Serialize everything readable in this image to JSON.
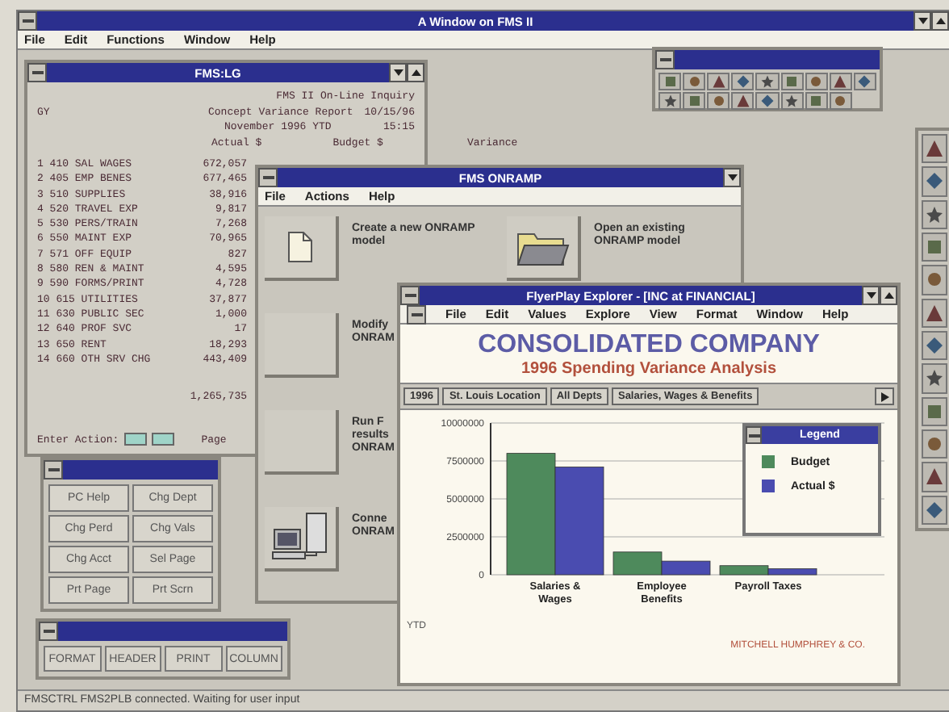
{
  "window": {
    "title": "A Window on FMS II"
  },
  "menu": [
    "File",
    "Edit",
    "Functions",
    "Window",
    "Help"
  ],
  "report": {
    "title": "FMS:LG",
    "header_right": "FMS II On-Line Inquiry",
    "code": "GY",
    "heading": "Concept Variance Report",
    "period": "November 1996 YTD",
    "date": "10/15/96",
    "time": "15:15",
    "columns": [
      "Actual $",
      "Budget $",
      "Variance"
    ],
    "rows": [
      {
        "label": "1 410 SAL WAGES",
        "actual": "672,057"
      },
      {
        "label": "2 405 EMP BENES",
        "actual": "677,465"
      },
      {
        "label": "3 510 SUPPLIES",
        "actual": "38,916"
      },
      {
        "label": "4 520 TRAVEL EXP",
        "actual": "9,817"
      },
      {
        "label": "5 530 PERS/TRAIN",
        "actual": "7,268"
      },
      {
        "label": "6 550 MAINT EXP",
        "actual": "70,965"
      },
      {
        "label": "7 571 OFF EQUIP",
        "actual": "827"
      },
      {
        "label": "8 580 REN & MAINT",
        "actual": "4,595"
      },
      {
        "label": "9 590 FORMS/PRINT",
        "actual": "4,728"
      },
      {
        "label": "10 615 UTILITIES",
        "actual": "37,877"
      },
      {
        "label": "11 630 PUBLIC SEC",
        "actual": "1,000"
      },
      {
        "label": "12 640 PROF SVC",
        "actual": "17"
      },
      {
        "label": "13 650 RENT",
        "actual": "18,293"
      },
      {
        "label": "14 660 OTH SRV CHG",
        "actual": "443,409"
      }
    ],
    "total": "1,265,735",
    "action_label": "Enter Action:",
    "page_label": "Page"
  },
  "keys": [
    "PC Help",
    "Chg Dept",
    "Chg Perd",
    "Chg Vals",
    "Chg Acct",
    "Sel Page",
    "Prt Page",
    "Prt Scrn"
  ],
  "print_keys": [
    "FORMAT",
    "HEADER",
    "PRINT",
    "COLUMN"
  ],
  "onramp": {
    "title": "FMS ONRAMP",
    "menu": [
      "File",
      "Actions",
      "Help"
    ],
    "left_items": [
      {
        "kind": "new",
        "text": "Create a new ONRAMP\nmodel"
      },
      {
        "kind": "blank",
        "text": "Modify\nONRAM"
      },
      {
        "kind": "blank",
        "text": "Run F\nresults\nONRAM"
      },
      {
        "kind": "connect",
        "text": "Conne\nONRAM"
      }
    ],
    "right_items": [
      {
        "kind": "open",
        "text": "Open an existing\nONRAMP model"
      }
    ]
  },
  "explorer": {
    "title": "FlyerPlay Explorer - [INC at FINANCIAL]",
    "menu": [
      "File",
      "Edit",
      "Values",
      "Explore",
      "View",
      "Format",
      "Window",
      "Help"
    ],
    "heading": "CONSOLIDATED COMPANY",
    "subheading": "1996 Spending Variance Analysis",
    "filters": [
      "1996",
      "St. Louis Location",
      "All Depts",
      "Salaries, Wages & Benefits"
    ],
    "legend_title": "Legend",
    "footnote": "YTD",
    "credit": "MITCHELL HUMPHREY & CO.",
    "chart_data": {
      "type": "bar",
      "categories": [
        "Salaries & Wages",
        "Employee Benefits",
        "Payroll Taxes"
      ],
      "series": [
        {
          "name": "Budget",
          "color": "#4e8a5c",
          "values": [
            8000000,
            1500000,
            600000
          ]
        },
        {
          "name": "Actual $",
          "color": "#4a4cb0",
          "values": [
            7100000,
            900000,
            400000
          ]
        }
      ],
      "ylim": [
        0,
        10000000
      ],
      "grid": true,
      "yticks": [
        0,
        2500000,
        5000000,
        7500000,
        10000000
      ]
    }
  },
  "status_bar": "FMSCTRL FMS2PLB connected. Waiting for user input"
}
